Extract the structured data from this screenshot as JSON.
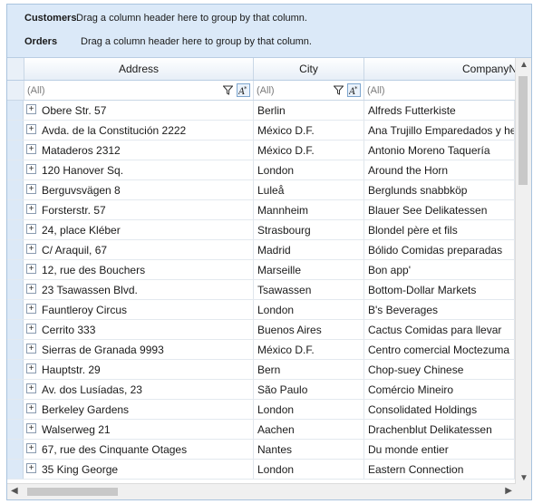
{
  "group_panel": {
    "rows": [
      {
        "level": "Customers",
        "hint": "Drag a column header here to group by that column."
      },
      {
        "level": "Orders",
        "hint": "Drag a column header here to group by that column."
      }
    ]
  },
  "columns": [
    {
      "header": "Address",
      "filter_value": "(All)"
    },
    {
      "header": "City",
      "filter_value": "(All)"
    },
    {
      "header": "CompanyNa",
      "filter_value": "(All)"
    }
  ],
  "rows": [
    [
      "Obere Str. 57",
      "Berlin",
      "Alfreds Futterkiste"
    ],
    [
      "Avda. de la Constitución 2222",
      "México D.F.",
      "Ana Trujillo Emparedados y hel"
    ],
    [
      "Mataderos  2312",
      "México D.F.",
      "Antonio Moreno Taquería"
    ],
    [
      "120 Hanover Sq.",
      "London",
      "Around the Horn"
    ],
    [
      "Berguvsvägen  8",
      "Luleå",
      "Berglunds snabbköp"
    ],
    [
      "Forsterstr. 57",
      "Mannheim",
      "Blauer See Delikatessen"
    ],
    [
      "24, place Kléber",
      "Strasbourg",
      "Blondel père et fils"
    ],
    [
      "C/ Araquil, 67",
      "Madrid",
      "Bólido Comidas preparadas"
    ],
    [
      "12, rue des Bouchers",
      "Marseille",
      "Bon app'"
    ],
    [
      "23 Tsawassen Blvd.",
      "Tsawassen",
      "Bottom-Dollar Markets"
    ],
    [
      "Fauntleroy Circus",
      "London",
      "B's Beverages"
    ],
    [
      "Cerrito 333",
      "Buenos Aires",
      "Cactus Comidas para llevar"
    ],
    [
      "Sierras de Granada 9993",
      "México D.F.",
      "Centro comercial Moctezuma"
    ],
    [
      "Hauptstr. 29",
      "Bern",
      "Chop-suey Chinese"
    ],
    [
      "Av. dos Lusíadas, 23",
      "São Paulo",
      "Comércio Mineiro"
    ],
    [
      "Berkeley Gardens",
      "London",
      "Consolidated Holdings"
    ],
    [
      "Walserweg 21",
      "Aachen",
      "Drachenblut Delikatessen"
    ],
    [
      "67, rue des Cinquante Otages",
      "Nantes",
      "Du monde entier"
    ],
    [
      "35 King George",
      "London",
      "Eastern Connection"
    ]
  ],
  "icons": {
    "filter": "filter-icon",
    "operator": "filter-operator-icon",
    "expand": "expand-plus-icon"
  },
  "colors": {
    "group_panel": "#dbe9f8",
    "border": "#a9c3de",
    "selector": "#dce9f7"
  }
}
